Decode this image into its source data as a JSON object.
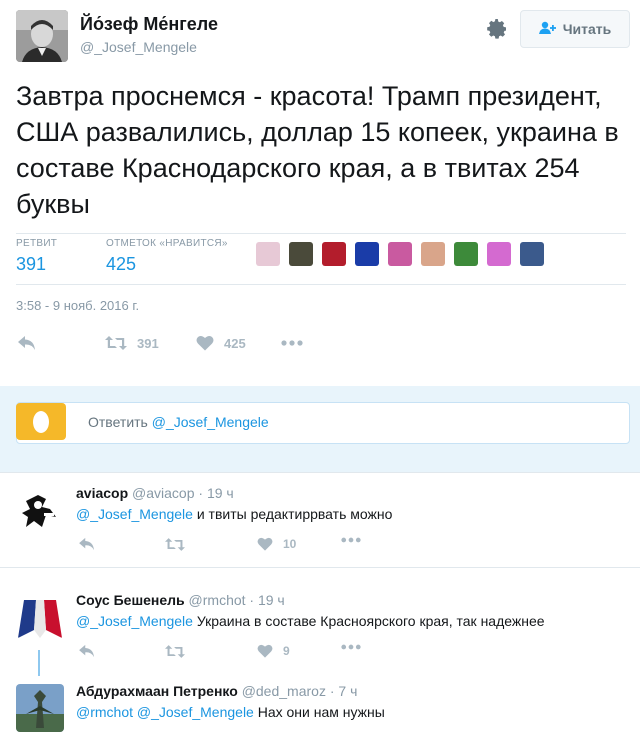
{
  "main": {
    "display_name": "Йо́зеф Ме́нгеле",
    "handle": "@_Josef_Mengele",
    "follow_label": "Читать",
    "tweet_text": "Завтра проснемся - красота! Трамп президент, США развалились, доллар 15 копеек, украина в составе Краснодарского края, а в твитах 254 буквы",
    "stats": {
      "retweets_label": "РЕТВИТ",
      "retweets": "391",
      "likes_label": "ОТМЕТОК «НРАВИТСЯ»",
      "likes": "425"
    },
    "likers_colors": [
      "#e7c9d6",
      "#4a4a3a",
      "#b31d2c",
      "#1a3ca8",
      "#c95aa0",
      "#d9a58a",
      "#3d8a3a",
      "#d46ad0",
      "#3b5a8c"
    ],
    "date": "3:58 - 9 нояб. 2016 г.",
    "actions": {
      "retweet_count": "391",
      "like_count": "425"
    }
  },
  "reply_box": {
    "placeholder_prefix": "Ответить ",
    "placeholder_mention": "@_Josef_Mengele"
  },
  "replies": [
    {
      "name": "aviacop",
      "handle": "@aviacop",
      "time": "· 19 ч",
      "mention": "@_Josef_Mengele",
      "text": " и твиты редактиррвать можно",
      "like_count": "10"
    },
    {
      "name": "Соус Бешенель",
      "handle": "@rmchot",
      "time": "· 19 ч",
      "mention": "@_Josef_Mengele",
      "text": " Украина в составе Красноярского края, так надежнее",
      "like_count": "9"
    },
    {
      "name": "Абдурахмаан Петренко",
      "handle": "@ded_maroz",
      "time": "· 7 ч",
      "mention": "@rmchot @_Josef_Mengele",
      "text": " Нах они нам нужны"
    }
  ],
  "icons": {
    "settings": "gear-icon",
    "follow": "add-user-icon",
    "reply": "reply-icon",
    "retweet": "retweet-icon",
    "like": "heart-icon",
    "more": "more-icon"
  },
  "colors": {
    "link": "#1b95e0",
    "muted": "#8899a6",
    "reply_bg": "#e8f4fb"
  }
}
